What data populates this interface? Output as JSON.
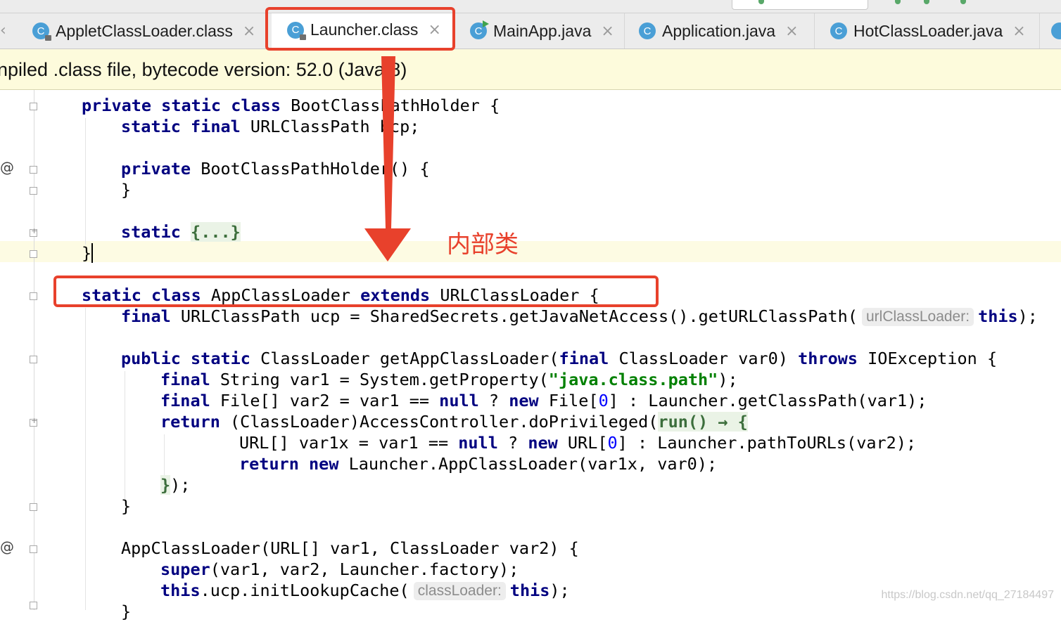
{
  "tabs": [
    {
      "label": "AppletClassLoader.class",
      "icon": "class-locked-icon",
      "active": false
    },
    {
      "label": "Launcher.class",
      "icon": "class-locked-icon",
      "active": true
    },
    {
      "label": "MainApp.java",
      "icon": "class-runnable-icon",
      "active": false
    },
    {
      "label": "Application.java",
      "icon": "class-icon",
      "active": false
    },
    {
      "label": "HotClassLoader.java",
      "icon": "class-icon",
      "active": false
    }
  ],
  "banner": {
    "text": "npiled .class file, bytecode version: 52.0 (Java 8)"
  },
  "code": {
    "l1_kw": "private static class",
    "l1_rest": " BootClassPathHolder {",
    "l2_kw": "static final",
    "l2_rest": " URLClassPath bcp;",
    "l4_kw": "private",
    "l4_rest": " BootClassPathHolder() {",
    "l5": "}",
    "l7_kw": "static",
    "l7_fold": "{...}",
    "l8": "}",
    "l10_kw1": "static class",
    "l10_mid": " AppClassLoader ",
    "l10_kw2": "extends",
    "l10_rest": " URLClassLoader {",
    "l11_kw": "final",
    "l11_rest": " URLClassPath ucp = SharedSecrets.getJavaNetAccess().getURLClassPath(",
    "l11_hint": "urlClassLoader:",
    "l11_this": "this",
    "l11_end": ");",
    "l13_kw1": "public static",
    "l13_mid": " ClassLoader getAppClassLoader(",
    "l13_kw2": "final",
    "l13_mid2": " ClassLoader var0) ",
    "l13_kw3": "throws",
    "l13_rest": " IOException {",
    "l14_kw": "final",
    "l14_mid": " String var1 = System.getProperty(",
    "l14_str": "\"java.class.path\"",
    "l14_rest": ");",
    "l15_kw": "final",
    "l15_mid": " File[] var2 = var1 == ",
    "l15_null": "null",
    "l15_q": " ? ",
    "l15_new": "new",
    "l15_file": " File[",
    "l15_num": "0",
    "l15_rest": "] : Launcher.getClassPath(var1);",
    "l16_kw": "return",
    "l16_mid": " (ClassLoader)AccessController.doPrivileged(",
    "l16_fold": "run() → {",
    "l17_mid": "URL[] var1x = var1 == ",
    "l17_null": "null",
    "l17_q": " ? ",
    "l17_new": "new",
    "l17_url": " URL[",
    "l17_num": "0",
    "l17_rest": "] : Launcher.pathToURLs(var2);",
    "l18_kw": "return",
    "l18_new": " new",
    "l18_rest": " Launcher.AppClassLoader(var1x, var0);",
    "l19_fold": "}",
    "l19_rest": ");",
    "l20": "}",
    "l22": "AppClassLoader(URL[] var1, ClassLoader var2) {",
    "l23_kw": "super",
    "l23_rest": "(var1, var2, Launcher.factory);",
    "l24_kw": "this",
    "l24_mid": ".ucp.initLookupCache(",
    "l24_hint": "classLoader:",
    "l24_this": "this",
    "l24_end": ");",
    "l25": "}"
  },
  "gutter": {
    "at_symbol": "@"
  },
  "annotation": {
    "label": "内部类",
    "color": "#e8412c"
  },
  "watermark": "https://blog.csdn.net/qq_27184497"
}
